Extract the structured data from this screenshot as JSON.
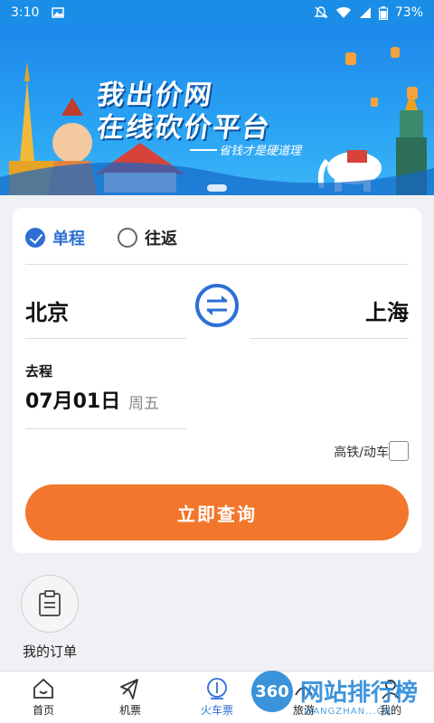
{
  "status_bar": {
    "time": "3:10",
    "battery": "73%"
  },
  "banner": {
    "title_line1": "我出价网",
    "title_line2": "在线砍价平台",
    "slogan": "省钱才是硬道理"
  },
  "search_form": {
    "trip_types": [
      {
        "label": "单程",
        "selected": true
      },
      {
        "label": "往返",
        "selected": false
      }
    ],
    "from_city": "北京",
    "to_city": "上海",
    "departure_label": "去程",
    "departure_date": "07月01日",
    "departure_weekday": "周五",
    "high_speed_label": "高铁/动车",
    "high_speed_checked": false,
    "search_button": "立即查询"
  },
  "orders": {
    "label": "我的订单"
  },
  "tabbar": {
    "items": [
      {
        "label": "首页",
        "icon": "home-icon",
        "active": false
      },
      {
        "label": "机票",
        "icon": "plane-icon",
        "active": false
      },
      {
        "label": "火车票",
        "icon": "train-icon",
        "active": true
      },
      {
        "label": "旅游",
        "icon": "travel-icon",
        "active": false
      },
      {
        "label": "我的",
        "icon": "user-icon",
        "active": false
      }
    ]
  },
  "watermark": {
    "badge": "360",
    "text": "网站排行榜",
    "sub": "WANGZHAN...CN"
  },
  "colors": {
    "accent": "#2d6fd6",
    "button": "#f2772c",
    "banner": "#1d87ea"
  }
}
